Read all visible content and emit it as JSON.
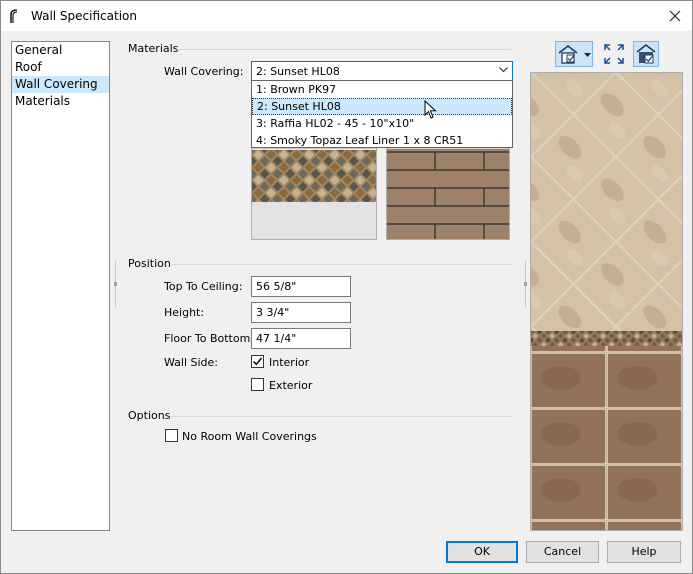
{
  "window": {
    "title": "Wall Specification"
  },
  "nav": {
    "items": [
      "General",
      "Roof",
      "Wall Covering",
      "Materials"
    ],
    "selected": "Wall Covering"
  },
  "materials": {
    "group_label": "Materials",
    "wall_covering_label": "Wall Covering:",
    "selected_value": "2: Sunset HL08",
    "options": [
      "1: Brown PK97",
      "2: Sunset HL08",
      "3: Raffia HL02 - 45 - 10\"x10\"",
      "4: Smoky Topaz Leaf Liner 1 x 8 CR51"
    ]
  },
  "position": {
    "group_label": "Position",
    "top_to_ceiling_label": "Top To Ceiling:",
    "top_to_ceiling_value": "56 5/8\"",
    "height_label": "Height:",
    "height_value": "3 3/4\"",
    "floor_to_bottom_label": "Floor To Bottom:",
    "floor_to_bottom_value": "47 1/4\"",
    "wall_side_label": "Wall Side:",
    "interior_label": "Interior",
    "interior_checked": true,
    "exterior_label": "Exterior",
    "exterior_checked": false
  },
  "options": {
    "group_label": "Options",
    "no_room_label": "No Room Wall Coverings",
    "no_room_checked": false
  },
  "buttons": {
    "ok": "OK",
    "cancel": "Cancel",
    "help": "Help"
  },
  "toolbar_icons": [
    "house-view-icon",
    "dropdown-arrow-icon",
    "fit-view-icon",
    "wall-view-icon"
  ]
}
